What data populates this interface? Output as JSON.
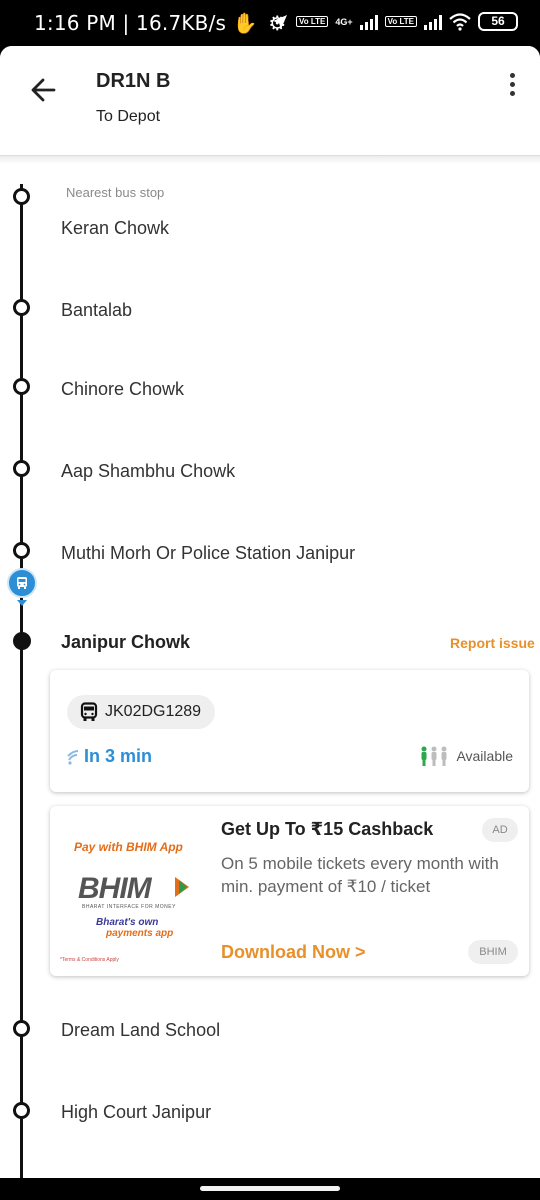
{
  "status_bar": {
    "time_speed": "1:16 PM | 16.7KB/s",
    "network_label": "4G+",
    "lte_label_1": "Vo LTE",
    "lte_label_2": "Vo LTE",
    "battery": "56"
  },
  "header": {
    "route_name": "DR1N B",
    "direction": "To Depot"
  },
  "stops": {
    "nearest_label": "Nearest bus stop",
    "items": [
      "Keran Chowk",
      "Bantalab",
      "Chinore Chowk",
      "Aap Shambhu Chowk",
      "Muthi Morh Or Police Station Janipur",
      "Janipur Chowk",
      "Dream Land School",
      "High Court Janipur"
    ],
    "current_index": 5
  },
  "report_issue": "Report issue",
  "bus_card": {
    "plate": "JK02DG1289",
    "eta": "In 3 min",
    "availability": "Available"
  },
  "ad": {
    "pay_with": "Pay with BHIM App",
    "logo_text": "BHIM",
    "logo_subtext": "BHARAT INTERFACE FOR MONEY",
    "tagline_1": "Bharat's own",
    "tagline_2": "payments app",
    "terms": "*Terms & Conditions Apply",
    "title": "Get Up To ₹15 Cashback",
    "body": "On 5 mobile tickets every month with min. payment of ₹10 / ticket",
    "cta": "Download Now >",
    "badge": "AD",
    "brand": "BHIM"
  },
  "colors": {
    "accent_blue": "#2c8fd6",
    "accent_orange": "#e8902a",
    "timeline": "#111111"
  }
}
